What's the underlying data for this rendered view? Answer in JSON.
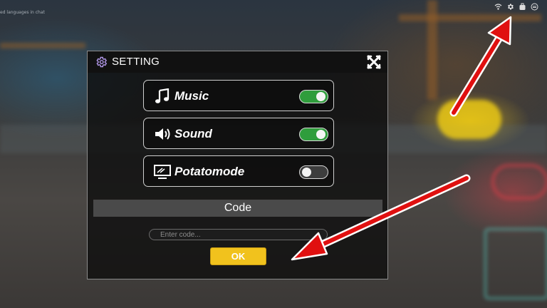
{
  "chat_hint": "ed languages in chat",
  "topbar": {
    "icons": [
      "network-icon",
      "gear-icon",
      "backpack-icon",
      "menu-icon"
    ]
  },
  "modal": {
    "title": "SETTING",
    "options": [
      {
        "label": "Music",
        "icon": "music-note-icon",
        "enabled": true
      },
      {
        "label": "Sound",
        "icon": "speaker-icon",
        "enabled": true
      },
      {
        "label": "Potatomode",
        "icon": "monitor-icon",
        "enabled": false
      }
    ],
    "code_header": "Code",
    "code_placeholder": "Enter code...",
    "ok_label": "OK"
  },
  "colors": {
    "toggle_on": "#2f9d3c",
    "toggle_off": "#3d3d3d",
    "ok_button": "#f1c21d",
    "annotation_arrow": "#e01010"
  }
}
